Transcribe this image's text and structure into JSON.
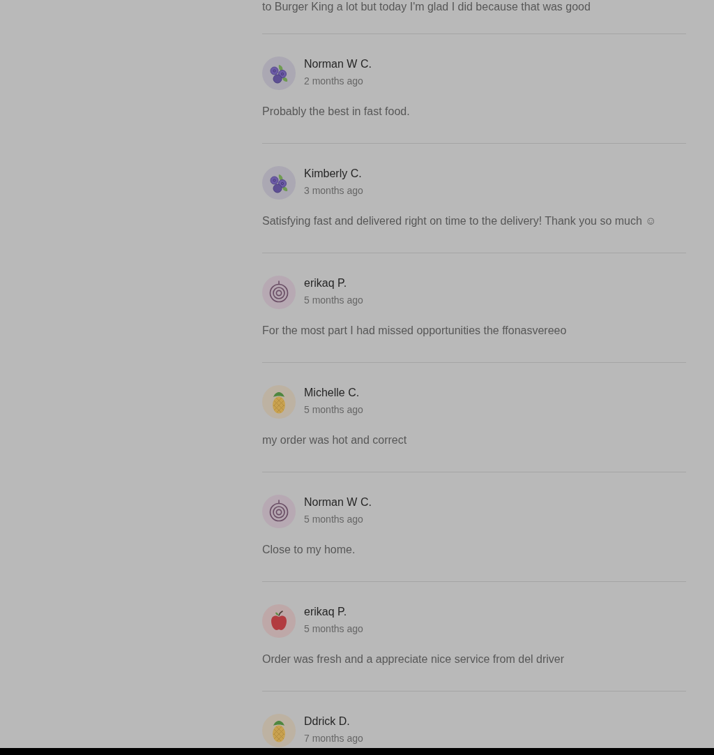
{
  "previous_review": {
    "text": "to Burger King a lot but today I'm glad I did because that was good"
  },
  "reviews": [
    {
      "avatar": {
        "kind": "berries"
      },
      "name": "Norman W C.",
      "date": "2 months ago",
      "text": "Probably the best in fast food."
    },
    {
      "avatar": {
        "kind": "berries"
      },
      "name": "Kimberly C.",
      "date": "3 months ago",
      "text": "Satisfying fast and delivered right on time to the delivery! Thank you so much ☺"
    },
    {
      "avatar": {
        "kind": "onion"
      },
      "name": "erikaq P.",
      "date": "5 months ago",
      "text": "For the most part I had missed opportunities the ffonasvereeo"
    },
    {
      "avatar": {
        "kind": "pineapple"
      },
      "name": "Michelle C.",
      "date": "5 months ago",
      "text": "my order was hot and correct"
    },
    {
      "avatar": {
        "kind": "onion"
      },
      "name": "Norman W C.",
      "date": "5 months ago",
      "text": "Close to my home."
    },
    {
      "avatar": {
        "kind": "apple"
      },
      "name": "erikaq P.",
      "date": "5 months ago",
      "text": "Order was fresh and a appreciate nice service from del driver"
    },
    {
      "avatar": {
        "kind": "pineapple"
      },
      "name": "Ddrick D.",
      "date": "7 months ago"
    }
  ]
}
